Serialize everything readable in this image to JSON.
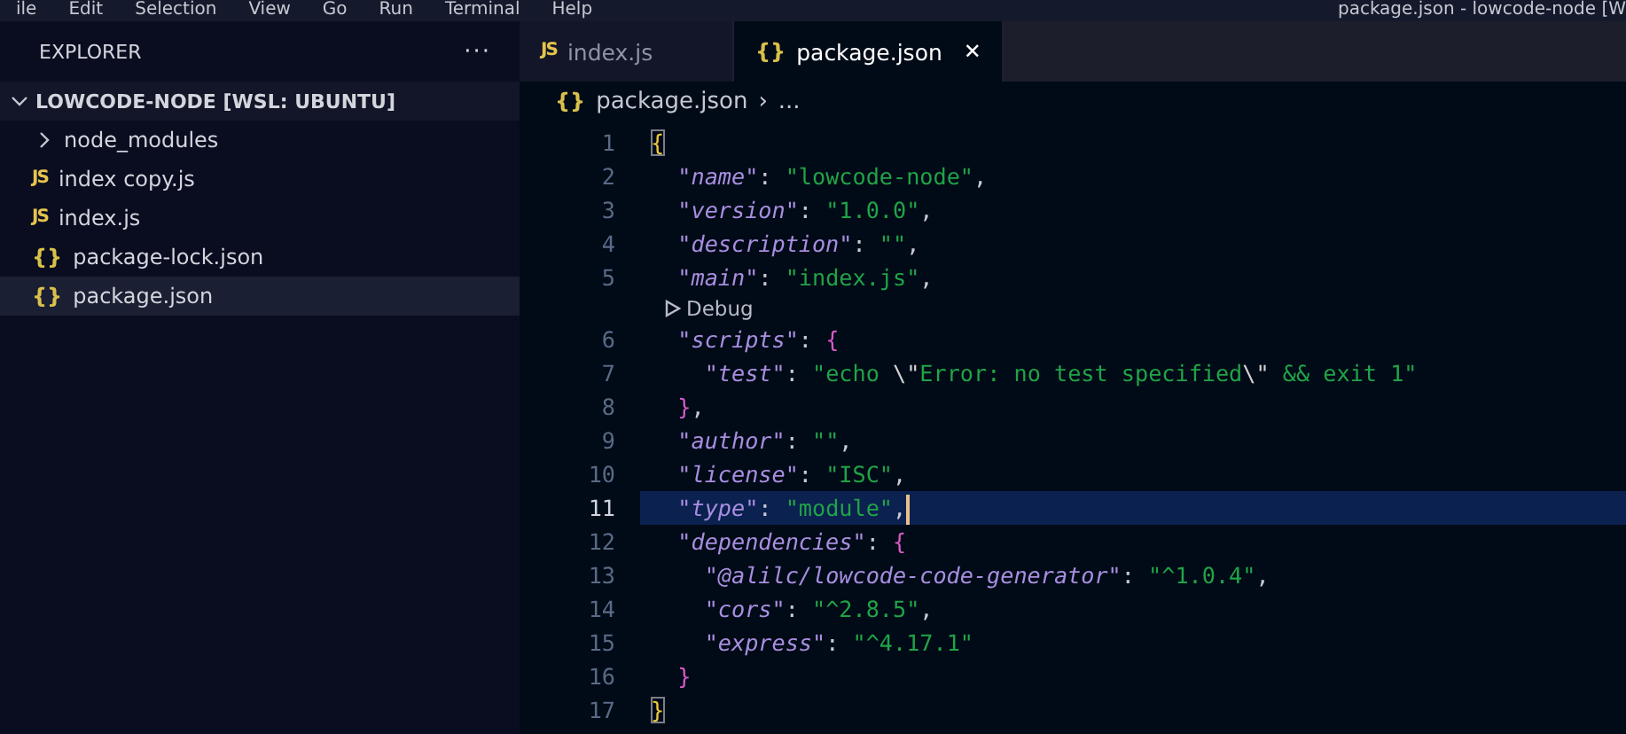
{
  "menu_bar": {
    "items": [
      "ile",
      "Edit",
      "Selection",
      "View",
      "Go",
      "Run",
      "Terminal",
      "Help"
    ],
    "title": "package.json - lowcode-node [W"
  },
  "sidebar": {
    "title": "EXPLORER",
    "more": "···",
    "root": {
      "label": "LOWCODE-NODE [WSL: UBUNTU]",
      "expanded": true,
      "children": [
        {
          "kind": "folder",
          "label": "node_modules",
          "expanded": false,
          "selected": false
        },
        {
          "kind": "js",
          "icon": "JS",
          "label": "index copy.js",
          "selected": false
        },
        {
          "kind": "js",
          "icon": "JS",
          "label": "index.js",
          "selected": false
        },
        {
          "kind": "json",
          "icon": "{}",
          "label": "package-lock.json",
          "selected": false
        },
        {
          "kind": "json",
          "icon": "{}",
          "label": "package.json",
          "selected": true
        }
      ]
    }
  },
  "tabs": [
    {
      "kind": "js",
      "icon": "JS",
      "label": "index.js",
      "selected": false
    },
    {
      "kind": "json",
      "icon": "{}",
      "label": "package.json",
      "selected": true,
      "close": "✕"
    }
  ],
  "breadcrumb": {
    "icon": "{}",
    "file": "package.json",
    "separator": "›",
    "rest": "..."
  },
  "editor": {
    "lines": [
      {
        "kind": "root",
        "number": "1",
        "current": false,
        "tokens": [
          {
            "kind": "matched-brace",
            "text": "{"
          }
        ]
      },
      {
        "kind": "member",
        "number": "2",
        "current": false,
        "tokens": [
          {
            "kind": "key",
            "text": "\"name\""
          },
          {
            "kind": "punct",
            "text": ": "
          },
          {
            "kind": "string",
            "text": "\"lowcode-node\""
          },
          {
            "kind": "punct",
            "text": ","
          }
        ]
      },
      {
        "kind": "member",
        "number": "3",
        "current": false,
        "tokens": [
          {
            "kind": "key",
            "text": "\"version\""
          },
          {
            "kind": "punct",
            "text": ": "
          },
          {
            "kind": "string",
            "text": "\"1.0.0\""
          },
          {
            "kind": "punct",
            "text": ","
          }
        ]
      },
      {
        "kind": "member",
        "number": "4",
        "current": false,
        "tokens": [
          {
            "kind": "key",
            "text": "\"description\""
          },
          {
            "kind": "punct",
            "text": ": "
          },
          {
            "kind": "string",
            "text": "\"\""
          },
          {
            "kind": "punct",
            "text": ","
          }
        ]
      },
      {
        "kind": "member",
        "number": "5",
        "current": false,
        "tokens": [
          {
            "kind": "key",
            "text": "\"main\""
          },
          {
            "kind": "punct",
            "text": ": "
          },
          {
            "kind": "string",
            "text": "\"index.js\""
          },
          {
            "kind": "punct",
            "text": ","
          }
        ]
      },
      {
        "kind": "codelens",
        "text": "Debug"
      },
      {
        "kind": "member",
        "number": "6",
        "current": false,
        "tokens": [
          {
            "kind": "key",
            "text": "\"scripts\""
          },
          {
            "kind": "punct",
            "text": ": "
          },
          {
            "kind": "brace2",
            "text": "{"
          }
        ]
      },
      {
        "kind": "nested",
        "number": "7",
        "current": false,
        "tokens": [
          {
            "kind": "key",
            "text": "\"test\""
          },
          {
            "kind": "punct",
            "text": ": "
          },
          {
            "kind": "string",
            "text": "\"echo "
          },
          {
            "kind": "escape",
            "text": "\\\""
          },
          {
            "kind": "string",
            "text": "Error: no test specified"
          },
          {
            "kind": "escape",
            "text": "\\\""
          },
          {
            "kind": "string",
            "text": " && exit 1\""
          }
        ]
      },
      {
        "kind": "member",
        "number": "8",
        "current": false,
        "tokens": [
          {
            "kind": "brace2",
            "text": "}"
          },
          {
            "kind": "punct",
            "text": ","
          }
        ]
      },
      {
        "kind": "member",
        "number": "9",
        "current": false,
        "tokens": [
          {
            "kind": "key",
            "text": "\"author\""
          },
          {
            "kind": "punct",
            "text": ": "
          },
          {
            "kind": "string",
            "text": "\"\""
          },
          {
            "kind": "punct",
            "text": ","
          }
        ]
      },
      {
        "kind": "member",
        "number": "10",
        "current": false,
        "tokens": [
          {
            "kind": "key",
            "text": "\"license\""
          },
          {
            "kind": "punct",
            "text": ": "
          },
          {
            "kind": "string",
            "text": "\"ISC\""
          },
          {
            "kind": "punct",
            "text": ","
          }
        ]
      },
      {
        "kind": "member",
        "number": "11",
        "current": true,
        "tokens": [
          {
            "kind": "key",
            "text": "\"type\""
          },
          {
            "kind": "punct",
            "text": ": "
          },
          {
            "kind": "string",
            "text": "\"module\""
          },
          {
            "kind": "punct",
            "text": ","
          }
        ]
      },
      {
        "kind": "member",
        "number": "12",
        "current": false,
        "tokens": [
          {
            "kind": "key",
            "text": "\"dependencies\""
          },
          {
            "kind": "punct",
            "text": ": "
          },
          {
            "kind": "brace2",
            "text": "{"
          }
        ]
      },
      {
        "kind": "nested",
        "number": "13",
        "current": false,
        "tokens": [
          {
            "kind": "key",
            "text": "\"@alilc/lowcode-code-generator\""
          },
          {
            "kind": "punct",
            "text": ": "
          },
          {
            "kind": "string",
            "text": "\"^1.0.4\""
          },
          {
            "kind": "punct",
            "text": ","
          }
        ]
      },
      {
        "kind": "nested",
        "number": "14",
        "current": false,
        "tokens": [
          {
            "kind": "key",
            "text": "\"cors\""
          },
          {
            "kind": "punct",
            "text": ": "
          },
          {
            "kind": "string",
            "text": "\"^2.8.5\""
          },
          {
            "kind": "punct",
            "text": ","
          }
        ]
      },
      {
        "kind": "nested",
        "number": "15",
        "current": false,
        "tokens": [
          {
            "kind": "key",
            "text": "\"express\""
          },
          {
            "kind": "punct",
            "text": ": "
          },
          {
            "kind": "string",
            "text": "\"^4.17.1\""
          }
        ]
      },
      {
        "kind": "member",
        "number": "16",
        "current": false,
        "tokens": [
          {
            "kind": "brace2",
            "text": "}"
          }
        ]
      },
      {
        "kind": "root",
        "number": "17",
        "current": false,
        "tokens": [
          {
            "kind": "matched-brace",
            "text": "}"
          }
        ]
      }
    ]
  }
}
